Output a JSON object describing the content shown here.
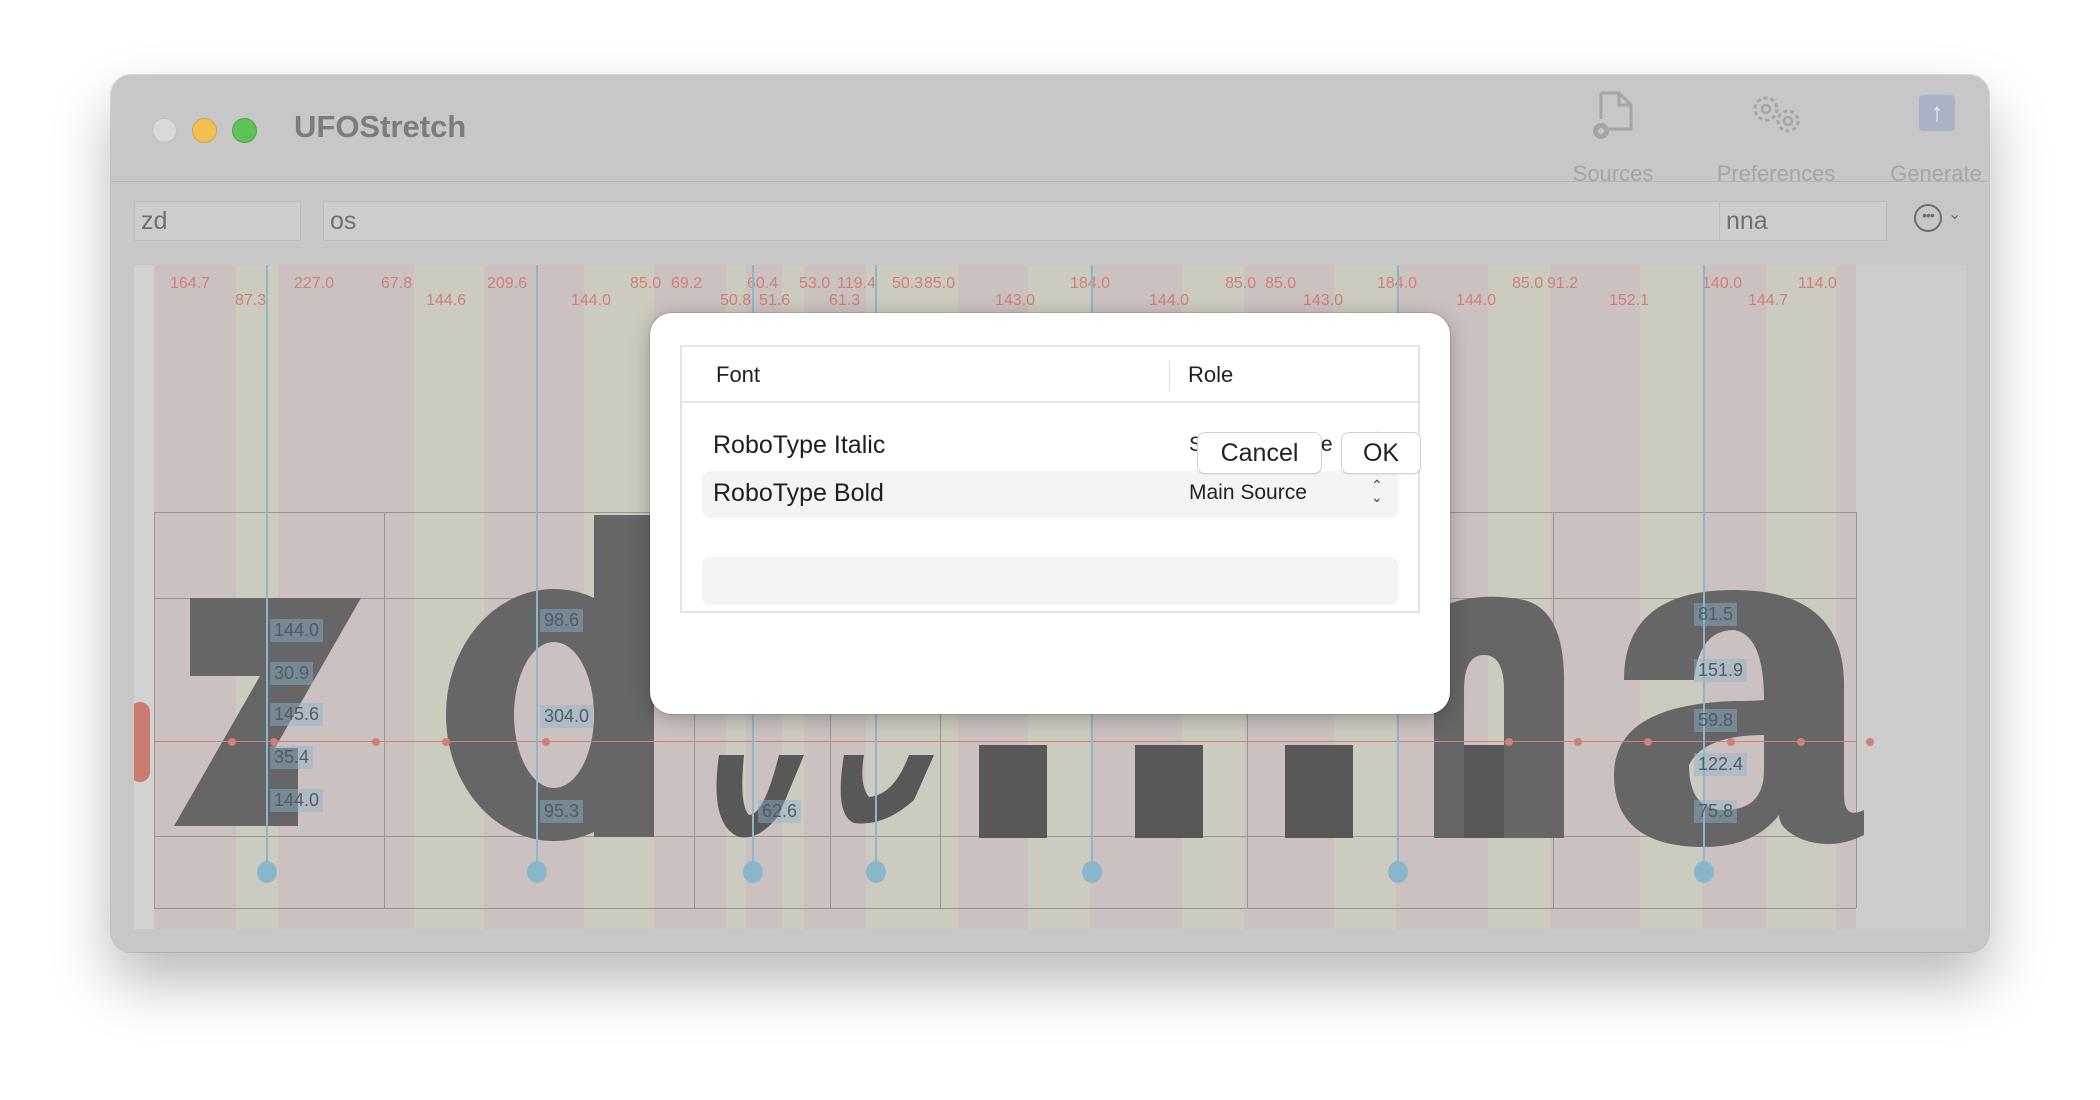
{
  "window": {
    "title": "UFOStretch",
    "toolbar": {
      "sources_label": "Sources",
      "preferences_label": "Preferences",
      "generate_label": "Generate"
    }
  },
  "fields": {
    "left_value": "zd",
    "middle_value": "os",
    "right_value": "nna"
  },
  "canvas": {
    "preview_text": "zdosnna",
    "top_metrics_row1": [
      "164.7",
      "227.0",
      "67.8",
      "209.6",
      "85.0",
      "69.2",
      "60.4",
      "53.0",
      "119.4",
      "50.3",
      "85.0",
      "184.0",
      "85.0",
      "85.0",
      "184.0",
      "85.0",
      "91.2",
      "140.0",
      "114.0"
    ],
    "top_metrics_row2": [
      "87.3",
      "144.6",
      "144.0",
      "50.8",
      "51.6",
      "61.3",
      "143.0",
      "144.0",
      "143.0",
      "144.0",
      "152.1",
      "144.7"
    ],
    "z_measurements": [
      "144.0",
      "30.9",
      "145.6",
      "35.4",
      "144.0"
    ],
    "d_measurements": [
      "98.6",
      "304.0",
      "95.3"
    ],
    "s_measurements": [
      "62.6"
    ],
    "a_measurements": [
      "81.5",
      "151.9",
      "59.8",
      "122.4",
      "75.8"
    ]
  },
  "dialog": {
    "columns": {
      "font": "Font",
      "role": "Role"
    },
    "rows": [
      {
        "font": "RoboType Italic",
        "role": "Second Source",
        "selected": false
      },
      {
        "font": "RoboType Bold",
        "role": "Main Source",
        "selected": true
      }
    ],
    "cancel_label": "Cancel",
    "ok_label": "OK"
  }
}
